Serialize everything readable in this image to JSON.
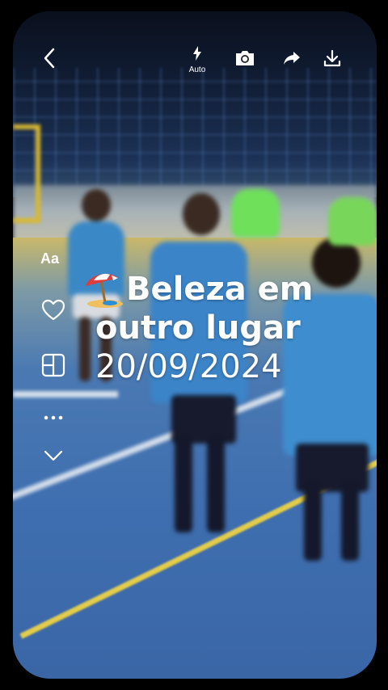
{
  "toolbar": {
    "back_icon": "chevron-left-icon",
    "flash_icon": "flash-icon",
    "flash_label": "Auto",
    "camera_icon": "camera-icon",
    "share_icon": "share-arrow-icon",
    "download_icon": "download-icon"
  },
  "sidebar": {
    "text_tool_label": "Aa",
    "like_icon": "heart-icon",
    "layout_icon": "layout-grid-icon",
    "more_icon": "more-dots-icon",
    "collapse_icon": "chevron-down-icon"
  },
  "caption": {
    "emoji": "beach-umbrella-emoji",
    "line1": "Beleza em",
    "line2": "outro lugar",
    "date": "20/09/2024"
  },
  "colors": {
    "background": "#000000",
    "caption_text": "#ffffff",
    "court_blue": "#3f6fb0",
    "court_line_yellow": "#e3cc4a"
  }
}
